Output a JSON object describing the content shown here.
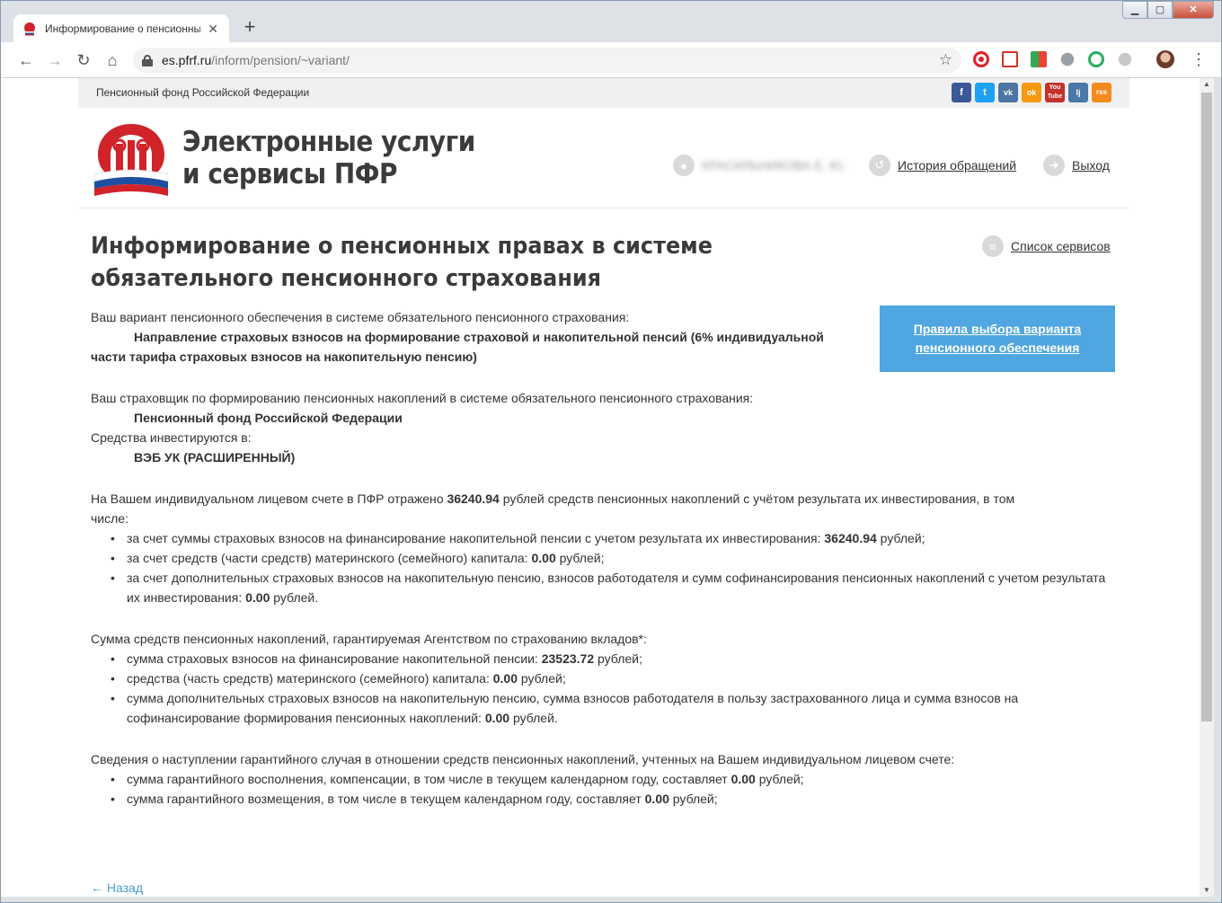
{
  "browser": {
    "tab_title": "Информирование о пенсионных правах",
    "url_host": "es.pfrf.ru",
    "url_path": "/inform/pension/~variant/"
  },
  "site": {
    "top_strip_text": "Пенсионный фонд Российской Федерации",
    "brand_line1": "Электронные услуги",
    "brand_line2": "и сервисы ПФР",
    "user_name": "КРАСИЛЬНИКОВА Е. Ю.",
    "history_link": "История обращений",
    "exit_link": "Выход",
    "socials": [
      "f",
      "t",
      "vk",
      "ok",
      "You Tube",
      "lj",
      "rss"
    ]
  },
  "main": {
    "title": "Информирование о пенсионных правах в системе обязательного пенсионного страхования",
    "services_link": "Список сервисов",
    "rules_button": "Правила выбора варианта пенсионного обеспечения",
    "variant_label": "Ваш вариант пенсионного обеспечения в системе обязательного пенсионного страхования:",
    "variant_value": "Направление страховых взносов на формирование страховой и накопительной пенсий (6% индивидуальной",
    "variant_value2": "части тарифа страховых взносов на накопительную пенсию)",
    "insurer_label": "Ваш страховщик по формированию пенсионных накоплений в системе обязательного пенсионного страхования:",
    "insurer_value": "Пенсионный фонд Российской Федерации",
    "invested_label": "Средства инвестируются в:",
    "invested_value": "ВЭБ УК (РАСШИРЕННЫЙ)",
    "account_pre": "На Вашем индивидуальном лицевом счете в ПФР отражено ",
    "account_amount": "36240.94",
    "account_post": " рублей средств пенсионных накоплений с учётом результата их инвестирования, в том",
    "account_post2": "числе:",
    "account_items": [
      {
        "pre": "за счет суммы страховых взносов на финансирование накопительной пенсии с учетом результата их инвестирования: ",
        "amount": "36240.94",
        "post": " рублей;"
      },
      {
        "pre": "за счет средств (части средств) материнского (семейного) капитала: ",
        "amount": "0.00",
        "post": " рублей;"
      },
      {
        "pre": "за счет дополнительных страховых взносов на накопительную пенсию, взносов работодателя и сумм софинансирования пенсионных накоплений с учетом результата их инвестирования: ",
        "amount": "0.00",
        "post": " рублей."
      }
    ],
    "guaranteed_label": "Сумма средств пенсионных накоплений, гарантируемая Агентством по страхованию вкладов*:",
    "guaranteed_items": [
      {
        "pre": "сумма страховых взносов на финансирование накопительной пенсии: ",
        "amount": "23523.72",
        "post": " рублей;"
      },
      {
        "pre": "средства (часть средств) материнского (семейного) капитала: ",
        "amount": "0.00",
        "post": " рублей;"
      },
      {
        "pre": "сумма дополнительных страховых взносов на накопительную пенсию, сумма взносов работодателя в пользу застрахованного лица и сумма взносов на софинансирование формирования пенсионных накоплений: ",
        "amount": "0.00",
        "post": " рублей."
      }
    ],
    "guarantee_case_label": "Сведения о наступлении гарантийного случая в отношении средств пенсионных накоплений, учтенных на Вашем индивидуальном лицевом счете:",
    "guarantee_case_items": [
      {
        "pre": "сумма гарантийного восполнения, компенсации, в том числе в текущем календарном году, составляет ",
        "amount": "0.00",
        "post": " рублей;"
      },
      {
        "pre": "сумма гарантийного возмещения, в том числе в текущем календарном году, составляет ",
        "amount": "0.00",
        "post": " рублей;"
      }
    ],
    "back_link": "← Назад"
  },
  "colors": {
    "accent_blue": "#4fa6e0",
    "link_blue": "#4a9ad4",
    "pfr_red": "#d0232a"
  }
}
